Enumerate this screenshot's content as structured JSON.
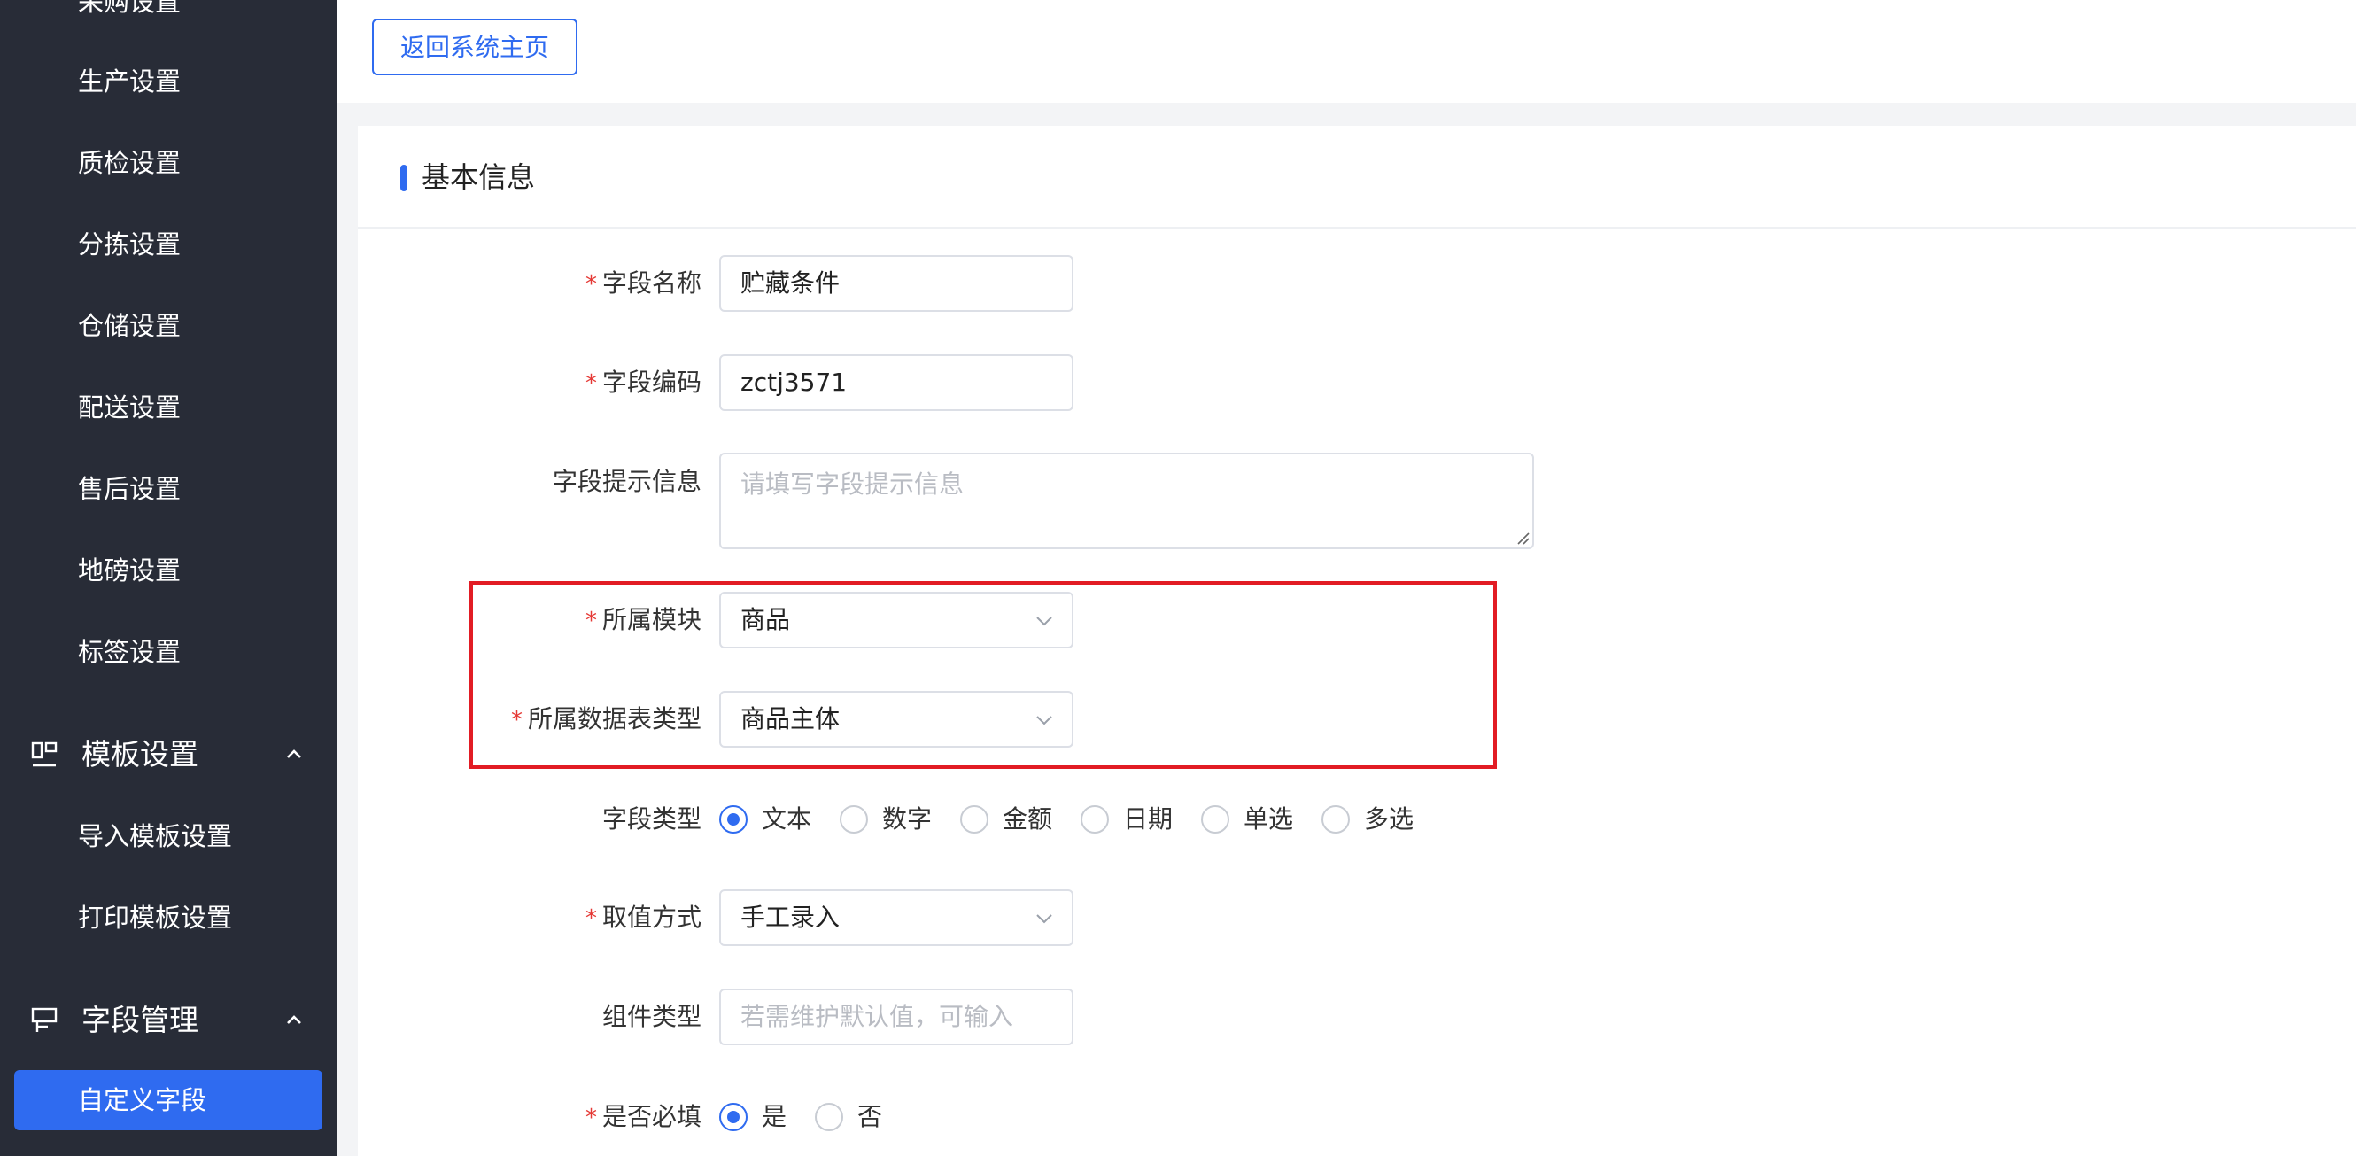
{
  "sidebar": {
    "items_top": [
      "采购设置",
      "生产设置",
      "质检设置",
      "分拣设置",
      "仓储设置",
      "配送设置",
      "售后设置",
      "地磅设置",
      "标签设置"
    ],
    "group_template": {
      "label": "模板设置",
      "icon": "layout-icon",
      "items": [
        "导入模板设置",
        "打印模板设置"
      ]
    },
    "group_fields": {
      "label": "字段管理",
      "icon": "field-icon",
      "active_item": "自定义字段"
    }
  },
  "topbar": {
    "back_button": "返回系统主页"
  },
  "card": {
    "title": "基本信息"
  },
  "form": {
    "field_name": {
      "label": "字段名称",
      "required": "*",
      "value": "贮藏条件"
    },
    "field_code": {
      "label": "字段编码",
      "required": "*",
      "value": "zctj3571"
    },
    "field_hint": {
      "label": "字段提示信息",
      "placeholder": "请填写字段提示信息"
    },
    "module": {
      "label": "所属模块",
      "required": "*",
      "value": "商品"
    },
    "table_type": {
      "label": "所属数据表类型",
      "required": "*",
      "value": "商品主体"
    },
    "field_type": {
      "label": "字段类型",
      "options": [
        "文本",
        "数字",
        "金额",
        "日期",
        "单选",
        "多选"
      ],
      "selected": "文本"
    },
    "value_mode": {
      "label": "取值方式",
      "required": "*",
      "value": "手工录入"
    },
    "component_type": {
      "label": "组件类型",
      "placeholder": "若需维护默认值，可输入"
    },
    "is_required": {
      "label": "是否必填",
      "required": "*",
      "options": [
        "是",
        "否"
      ],
      "selected": "是"
    }
  },
  "colors": {
    "sidebar_bg": "#282c37",
    "accent": "#2f6bf0",
    "highlight_border": "#e21c24",
    "required_mark": "#e53935"
  }
}
